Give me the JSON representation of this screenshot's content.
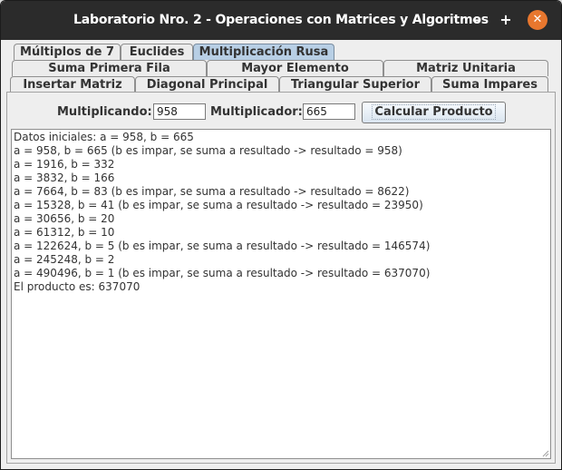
{
  "window": {
    "title": "Laboratorio Nro. 2 - Operaciones con Matrices y Algoritmos",
    "minimize_label": "–",
    "maximize_label": "+",
    "close_label": "✕"
  },
  "tabs": {
    "row1": [
      {
        "label": "Múltiplos de 7"
      },
      {
        "label": "Euclides"
      },
      {
        "label": "Multiplicación Rusa",
        "active": true
      }
    ],
    "row2": [
      {
        "label": "Suma Primera Fila"
      },
      {
        "label": "Mayor Elemento"
      },
      {
        "label": "Matriz Unitaria"
      }
    ],
    "row3": [
      {
        "label": "Insertar Matriz"
      },
      {
        "label": "Diagonal Principal"
      },
      {
        "label": "Triangular Superior"
      },
      {
        "label": "Suma Impares"
      }
    ]
  },
  "form": {
    "multiplicando_label": "Multiplicando:",
    "multiplicando_value": "958",
    "multiplicador_label": "Multiplicador:",
    "multiplicador_value": "665",
    "calc_button_label": "Calcular Producto"
  },
  "output": {
    "lines": [
      "Datos iniciales: a = 958, b = 665",
      "a = 958, b = 665 (b es impar, se suma a resultado -> resultado = 958)",
      "a = 1916, b = 332",
      "a = 3832, b = 166",
      "a = 7664, b = 83 (b es impar, se suma a resultado -> resultado = 8622)",
      "a = 15328, b = 41 (b es impar, se suma a resultado -> resultado = 23950)",
      "a = 30656, b = 20",
      "a = 61312, b = 10",
      "a = 122624, b = 5 (b es impar, se suma a resultado -> resultado = 146574)",
      "a = 245248, b = 2",
      "a = 490496, b = 1 (b es impar, se suma a resultado -> resultado = 637070)",
      "El producto es: 637070"
    ]
  },
  "colors": {
    "titlebar": "#2b2b2b",
    "active_tab": "#b8cfe5",
    "close_button": "#e8772e"
  }
}
